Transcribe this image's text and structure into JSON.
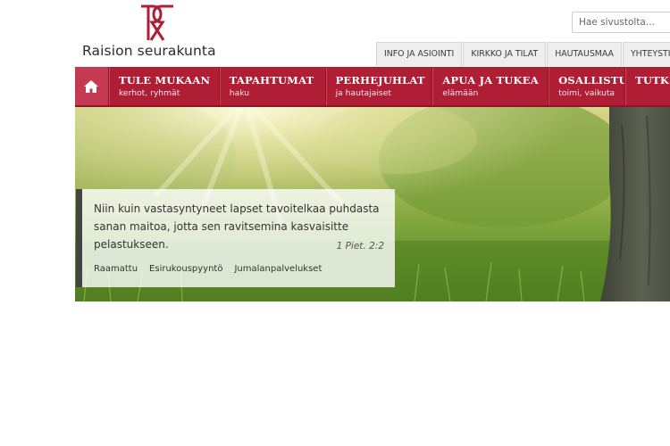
{
  "brand": {
    "name": "Raision seurakunta",
    "accent": "#b01e35"
  },
  "search": {
    "placeholder": "Hae sivustolta..."
  },
  "top_links": [
    "INFO JA ASIOINTI",
    "KIRKKO JA TILAT",
    "HAUTAUSMAA",
    "YHTEYSTIEDOT"
  ],
  "nav": {
    "home_icon": "house-icon",
    "items": [
      {
        "title": "TULE MUKAAN",
        "subtitle": "kerhot, ryhmät"
      },
      {
        "title": "TAPAHTUMAT",
        "subtitle": "haku"
      },
      {
        "title": "PERHEJUHLAT",
        "subtitle": "ja hautajaiset"
      },
      {
        "title": "APUA JA TUKEA",
        "subtitle": "elämään"
      },
      {
        "title": "OSALLISTU",
        "subtitle": "toimi, vaikuta"
      },
      {
        "title": "TUTK",
        "subtitle": ""
      }
    ]
  },
  "hero": {
    "quote": "Niin kuin vastasyntyneet lapset tavoitelkaa puhdasta sanan maitoa, jotta sen ravitsemina kasvaisitte pelastukseen.",
    "reference": "1 Piet. 2:2",
    "links": [
      "Raamattu",
      "Esirukouspyyntö",
      "Jumalanpalvelukset"
    ]
  }
}
